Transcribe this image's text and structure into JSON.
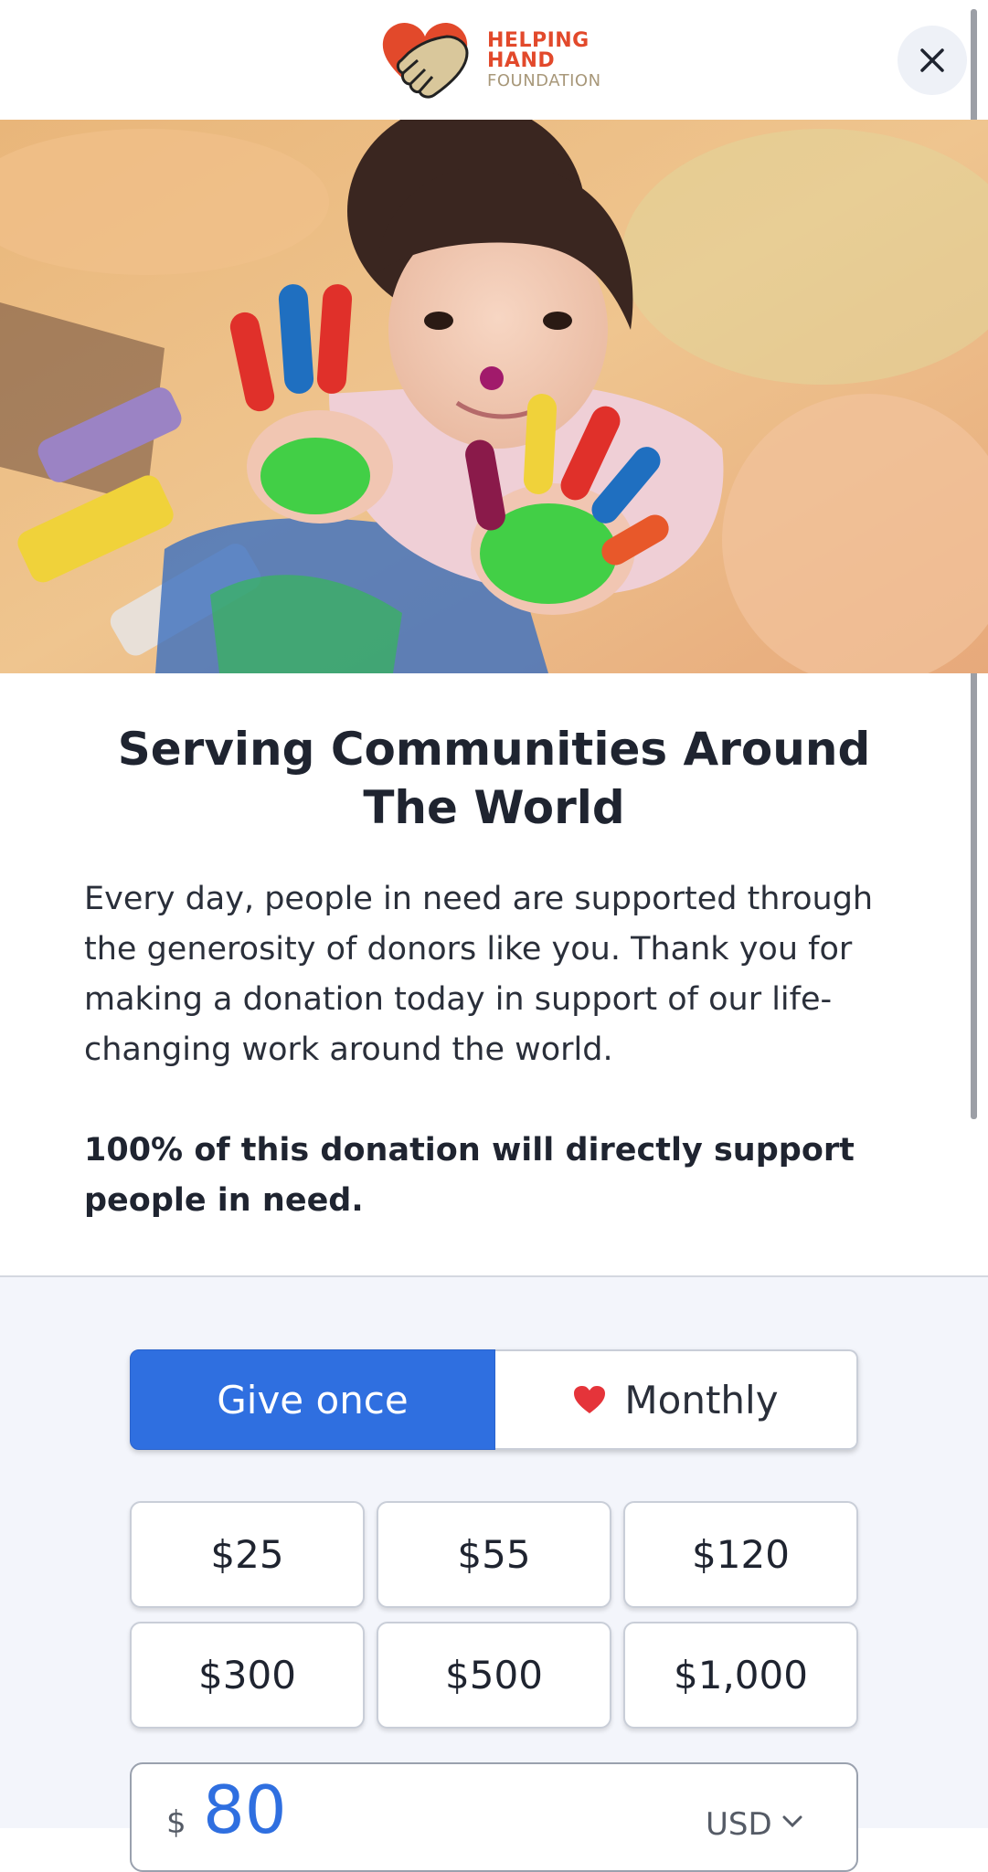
{
  "header": {
    "logo": {
      "line1": "HELPING",
      "line2": "HAND",
      "line3": "FOUNDATION"
    },
    "close_icon": "close-icon"
  },
  "hero": {
    "image": "child-with-painted-hands-photo"
  },
  "content": {
    "title": "Serving Communities Around The World",
    "description": "Every day, people in need are supported through the generosity of donors like you. Thank you for making a donation today in support of our life-changing work around the world.",
    "pledge": "100% of this donation will directly support people in need."
  },
  "donation": {
    "frequency": {
      "once_label": "Give once",
      "monthly_label": "Monthly",
      "selected": "once"
    },
    "amounts": [
      "$25",
      "$55",
      "$120",
      "$300",
      "$500",
      "$1,000"
    ],
    "custom": {
      "symbol": "$",
      "value": "80",
      "currency": "USD"
    }
  },
  "colors": {
    "accent": "#2f6fe0",
    "brand_red": "#e2492b",
    "panel_bg": "#f3f5fb"
  }
}
